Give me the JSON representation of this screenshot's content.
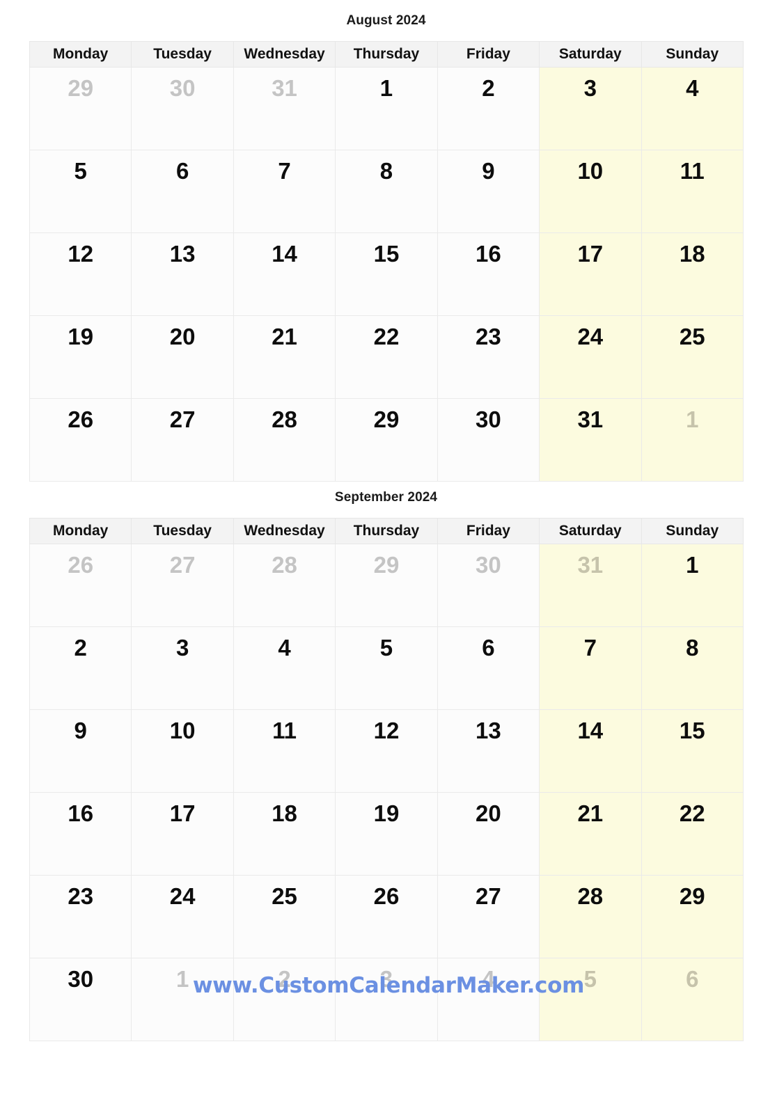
{
  "page": {
    "background": "#ffffff",
    "accent_blue": "#6b90e2",
    "weekend_background": "#fcfbdf",
    "header_background": "#f3f3f3",
    "grid_line": "#e7e7e7",
    "other_month_text": "#c4c4c4"
  },
  "weekday_headers": [
    "Monday",
    "Tuesday",
    "Wednesday",
    "Thursday",
    "Friday",
    "Saturday",
    "Sunday"
  ],
  "months": [
    {
      "id": "august",
      "title": "August 2024",
      "weeks": [
        [
          {
            "n": "29",
            "other": true,
            "weekend": false
          },
          {
            "n": "30",
            "other": true,
            "weekend": false
          },
          {
            "n": "31",
            "other": true,
            "weekend": false
          },
          {
            "n": "1",
            "other": false,
            "weekend": false
          },
          {
            "n": "2",
            "other": false,
            "weekend": false
          },
          {
            "n": "3",
            "other": false,
            "weekend": true
          },
          {
            "n": "4",
            "other": false,
            "weekend": true
          }
        ],
        [
          {
            "n": "5",
            "other": false,
            "weekend": false
          },
          {
            "n": "6",
            "other": false,
            "weekend": false
          },
          {
            "n": "7",
            "other": false,
            "weekend": false
          },
          {
            "n": "8",
            "other": false,
            "weekend": false
          },
          {
            "n": "9",
            "other": false,
            "weekend": false
          },
          {
            "n": "10",
            "other": false,
            "weekend": true
          },
          {
            "n": "11",
            "other": false,
            "weekend": true
          }
        ],
        [
          {
            "n": "12",
            "other": false,
            "weekend": false
          },
          {
            "n": "13",
            "other": false,
            "weekend": false
          },
          {
            "n": "14",
            "other": false,
            "weekend": false
          },
          {
            "n": "15",
            "other": false,
            "weekend": false
          },
          {
            "n": "16",
            "other": false,
            "weekend": false
          },
          {
            "n": "17",
            "other": false,
            "weekend": true
          },
          {
            "n": "18",
            "other": false,
            "weekend": true
          }
        ],
        [
          {
            "n": "19",
            "other": false,
            "weekend": false
          },
          {
            "n": "20",
            "other": false,
            "weekend": false
          },
          {
            "n": "21",
            "other": false,
            "weekend": false
          },
          {
            "n": "22",
            "other": false,
            "weekend": false
          },
          {
            "n": "23",
            "other": false,
            "weekend": false
          },
          {
            "n": "24",
            "other": false,
            "weekend": true
          },
          {
            "n": "25",
            "other": false,
            "weekend": true
          }
        ],
        [
          {
            "n": "26",
            "other": false,
            "weekend": false
          },
          {
            "n": "27",
            "other": false,
            "weekend": false
          },
          {
            "n": "28",
            "other": false,
            "weekend": false
          },
          {
            "n": "29",
            "other": false,
            "weekend": false
          },
          {
            "n": "30",
            "other": false,
            "weekend": false
          },
          {
            "n": "31",
            "other": false,
            "weekend": true
          },
          {
            "n": "1",
            "other": true,
            "weekend": true
          }
        ]
      ]
    },
    {
      "id": "september",
      "title": "September 2024",
      "weeks": [
        [
          {
            "n": "26",
            "other": true,
            "weekend": false
          },
          {
            "n": "27",
            "other": true,
            "weekend": false
          },
          {
            "n": "28",
            "other": true,
            "weekend": false
          },
          {
            "n": "29",
            "other": true,
            "weekend": false
          },
          {
            "n": "30",
            "other": true,
            "weekend": false
          },
          {
            "n": "31",
            "other": true,
            "weekend": true
          },
          {
            "n": "1",
            "other": false,
            "weekend": true
          }
        ],
        [
          {
            "n": "2",
            "other": false,
            "weekend": false
          },
          {
            "n": "3",
            "other": false,
            "weekend": false
          },
          {
            "n": "4",
            "other": false,
            "weekend": false
          },
          {
            "n": "5",
            "other": false,
            "weekend": false
          },
          {
            "n": "6",
            "other": false,
            "weekend": false
          },
          {
            "n": "7",
            "other": false,
            "weekend": true
          },
          {
            "n": "8",
            "other": false,
            "weekend": true
          }
        ],
        [
          {
            "n": "9",
            "other": false,
            "weekend": false
          },
          {
            "n": "10",
            "other": false,
            "weekend": false
          },
          {
            "n": "11",
            "other": false,
            "weekend": false
          },
          {
            "n": "12",
            "other": false,
            "weekend": false
          },
          {
            "n": "13",
            "other": false,
            "weekend": false
          },
          {
            "n": "14",
            "other": false,
            "weekend": true
          },
          {
            "n": "15",
            "other": false,
            "weekend": true
          }
        ],
        [
          {
            "n": "16",
            "other": false,
            "weekend": false
          },
          {
            "n": "17",
            "other": false,
            "weekend": false
          },
          {
            "n": "18",
            "other": false,
            "weekend": false
          },
          {
            "n": "19",
            "other": false,
            "weekend": false
          },
          {
            "n": "20",
            "other": false,
            "weekend": false
          },
          {
            "n": "21",
            "other": false,
            "weekend": true
          },
          {
            "n": "22",
            "other": false,
            "weekend": true
          }
        ],
        [
          {
            "n": "23",
            "other": false,
            "weekend": false
          },
          {
            "n": "24",
            "other": false,
            "weekend": false
          },
          {
            "n": "25",
            "other": false,
            "weekend": false
          },
          {
            "n": "26",
            "other": false,
            "weekend": false
          },
          {
            "n": "27",
            "other": false,
            "weekend": false
          },
          {
            "n": "28",
            "other": false,
            "weekend": true
          },
          {
            "n": "29",
            "other": false,
            "weekend": true
          }
        ],
        [
          {
            "n": "30",
            "other": false,
            "weekend": false
          },
          {
            "n": "1",
            "other": true,
            "weekend": false
          },
          {
            "n": "2",
            "other": true,
            "weekend": false
          },
          {
            "n": "3",
            "other": true,
            "weekend": false
          },
          {
            "n": "4",
            "other": true,
            "weekend": false
          },
          {
            "n": "5",
            "other": true,
            "weekend": true
          },
          {
            "n": "6",
            "other": true,
            "weekend": true
          }
        ]
      ]
    }
  ],
  "footer": {
    "url": "www.CustomCalendarMaker.com"
  }
}
